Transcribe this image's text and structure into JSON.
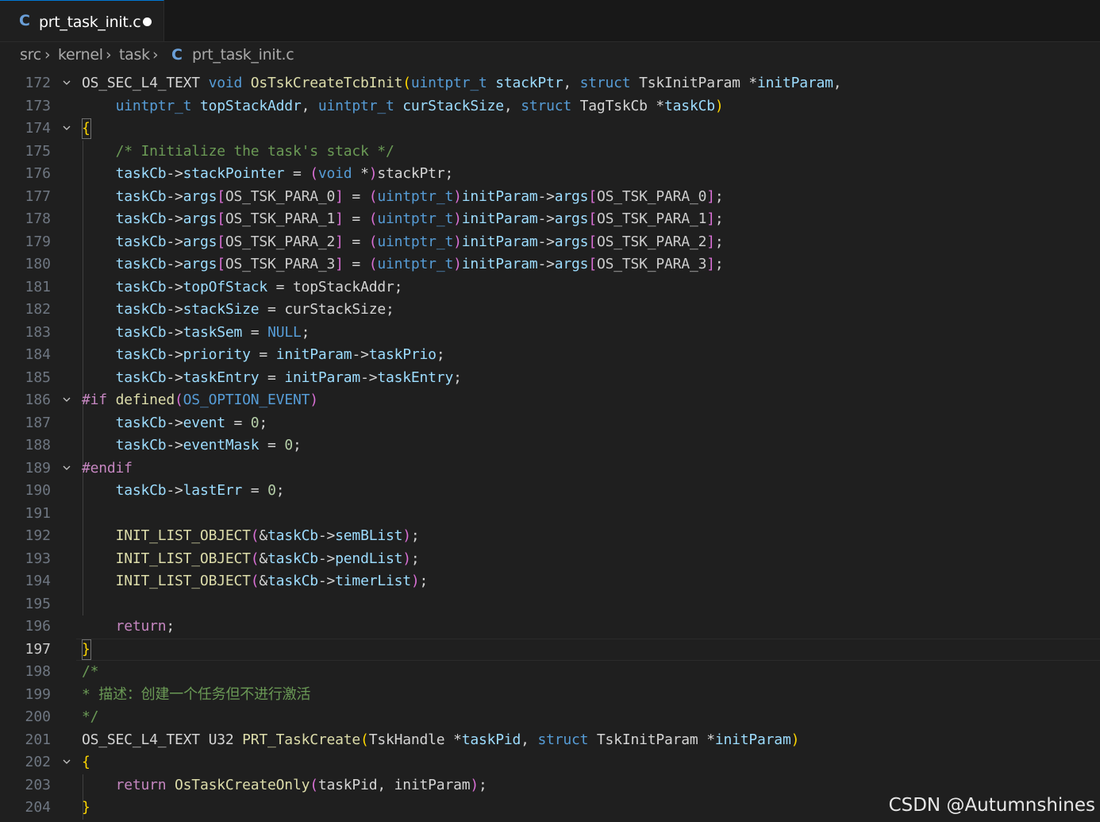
{
  "tab": {
    "icon": "c-language-icon",
    "icon_text": "C",
    "label": "prt_task_init.c",
    "dirty": true
  },
  "breadcrumb": {
    "items": [
      "src",
      "kernel",
      "task"
    ],
    "file_icon_text": "C",
    "file": "prt_task_init.c"
  },
  "active_line": 197,
  "lines": [
    {
      "n": "172",
      "fold": true,
      "t": [
        [
          "OS_SEC_L4_TEXT ",
          "plain"
        ],
        [
          "void ",
          "kw"
        ],
        [
          "OsTskCreateTcbInit",
          "fn"
        ],
        [
          "(",
          "p1"
        ],
        [
          "uintptr_t ",
          "kw"
        ],
        [
          "stackPtr",
          "var"
        ],
        [
          ", ",
          "plain"
        ],
        [
          "struct ",
          "kw"
        ],
        [
          "TskInitParam ",
          "plain"
        ],
        [
          "*",
          "plain"
        ],
        [
          "initParam",
          "var"
        ],
        [
          ",",
          "plain"
        ]
      ]
    },
    {
      "n": "173",
      "fold": false,
      "t": [
        [
          "    ",
          "plain"
        ],
        [
          "uintptr_t ",
          "kw"
        ],
        [
          "topStackAddr",
          "var"
        ],
        [
          ", ",
          "plain"
        ],
        [
          "uintptr_t ",
          "kw"
        ],
        [
          "curStackSize",
          "var"
        ],
        [
          ", ",
          "plain"
        ],
        [
          "struct ",
          "kw"
        ],
        [
          "TagTskCb ",
          "plain"
        ],
        [
          "*",
          "plain"
        ],
        [
          "taskCb",
          "var"
        ],
        [
          ")",
          "p1"
        ]
      ]
    },
    {
      "n": "174",
      "fold": true,
      "t": [
        [
          "{",
          "p1"
        ]
      ]
    },
    {
      "n": "175",
      "fold": false,
      "t": [
        [
          "    ",
          "plain"
        ],
        [
          "/* Initialize the task's stack */",
          "cm"
        ]
      ]
    },
    {
      "n": "176",
      "fold": false,
      "t": [
        [
          "    ",
          "plain"
        ],
        [
          "taskCb",
          "var"
        ],
        [
          "->",
          "plain"
        ],
        [
          "stackPointer",
          "var"
        ],
        [
          " = ",
          "plain"
        ],
        [
          "(",
          "p2"
        ],
        [
          "void ",
          "kw"
        ],
        [
          "*",
          "plain"
        ],
        [
          ")",
          "p2"
        ],
        [
          "stackPtr",
          "plain"
        ],
        [
          ";",
          "plain"
        ]
      ]
    },
    {
      "n": "177",
      "fold": false,
      "t": [
        [
          "    ",
          "plain"
        ],
        [
          "taskCb",
          "var"
        ],
        [
          "->",
          "plain"
        ],
        [
          "args",
          "var"
        ],
        [
          "[",
          "p2"
        ],
        [
          "OS_TSK_PARA_0",
          "mac"
        ],
        [
          "]",
          "p2"
        ],
        [
          " = ",
          "plain"
        ],
        [
          "(",
          "p2"
        ],
        [
          "uintptr_t",
          "kw"
        ],
        [
          ")",
          "p2"
        ],
        [
          "initParam",
          "var"
        ],
        [
          "->",
          "plain"
        ],
        [
          "args",
          "var"
        ],
        [
          "[",
          "p2"
        ],
        [
          "OS_TSK_PARA_0",
          "mac"
        ],
        [
          "]",
          "p2"
        ],
        [
          ";",
          "plain"
        ]
      ]
    },
    {
      "n": "178",
      "fold": false,
      "t": [
        [
          "    ",
          "plain"
        ],
        [
          "taskCb",
          "var"
        ],
        [
          "->",
          "plain"
        ],
        [
          "args",
          "var"
        ],
        [
          "[",
          "p2"
        ],
        [
          "OS_TSK_PARA_1",
          "mac"
        ],
        [
          "]",
          "p2"
        ],
        [
          " = ",
          "plain"
        ],
        [
          "(",
          "p2"
        ],
        [
          "uintptr_t",
          "kw"
        ],
        [
          ")",
          "p2"
        ],
        [
          "initParam",
          "var"
        ],
        [
          "->",
          "plain"
        ],
        [
          "args",
          "var"
        ],
        [
          "[",
          "p2"
        ],
        [
          "OS_TSK_PARA_1",
          "mac"
        ],
        [
          "]",
          "p2"
        ],
        [
          ";",
          "plain"
        ]
      ]
    },
    {
      "n": "179",
      "fold": false,
      "t": [
        [
          "    ",
          "plain"
        ],
        [
          "taskCb",
          "var"
        ],
        [
          "->",
          "plain"
        ],
        [
          "args",
          "var"
        ],
        [
          "[",
          "p2"
        ],
        [
          "OS_TSK_PARA_2",
          "mac"
        ],
        [
          "]",
          "p2"
        ],
        [
          " = ",
          "plain"
        ],
        [
          "(",
          "p2"
        ],
        [
          "uintptr_t",
          "kw"
        ],
        [
          ")",
          "p2"
        ],
        [
          "initParam",
          "var"
        ],
        [
          "->",
          "plain"
        ],
        [
          "args",
          "var"
        ],
        [
          "[",
          "p2"
        ],
        [
          "OS_TSK_PARA_2",
          "mac"
        ],
        [
          "]",
          "p2"
        ],
        [
          ";",
          "plain"
        ]
      ]
    },
    {
      "n": "180",
      "fold": false,
      "t": [
        [
          "    ",
          "plain"
        ],
        [
          "taskCb",
          "var"
        ],
        [
          "->",
          "plain"
        ],
        [
          "args",
          "var"
        ],
        [
          "[",
          "p2"
        ],
        [
          "OS_TSK_PARA_3",
          "mac"
        ],
        [
          "]",
          "p2"
        ],
        [
          " = ",
          "plain"
        ],
        [
          "(",
          "p2"
        ],
        [
          "uintptr_t",
          "kw"
        ],
        [
          ")",
          "p2"
        ],
        [
          "initParam",
          "var"
        ],
        [
          "->",
          "plain"
        ],
        [
          "args",
          "var"
        ],
        [
          "[",
          "p2"
        ],
        [
          "OS_TSK_PARA_3",
          "mac"
        ],
        [
          "]",
          "p2"
        ],
        [
          ";",
          "plain"
        ]
      ]
    },
    {
      "n": "181",
      "fold": false,
      "t": [
        [
          "    ",
          "plain"
        ],
        [
          "taskCb",
          "var"
        ],
        [
          "->",
          "plain"
        ],
        [
          "topOfStack",
          "var"
        ],
        [
          " = ",
          "plain"
        ],
        [
          "topStackAddr",
          "plain"
        ],
        [
          ";",
          "plain"
        ]
      ]
    },
    {
      "n": "182",
      "fold": false,
      "t": [
        [
          "    ",
          "plain"
        ],
        [
          "taskCb",
          "var"
        ],
        [
          "->",
          "plain"
        ],
        [
          "stackSize",
          "var"
        ],
        [
          " = ",
          "plain"
        ],
        [
          "curStackSize",
          "plain"
        ],
        [
          ";",
          "plain"
        ]
      ]
    },
    {
      "n": "183",
      "fold": false,
      "t": [
        [
          "    ",
          "plain"
        ],
        [
          "taskCb",
          "var"
        ],
        [
          "->",
          "plain"
        ],
        [
          "taskSem",
          "var"
        ],
        [
          " = ",
          "plain"
        ],
        [
          "NULL",
          "kw"
        ],
        [
          ";",
          "plain"
        ]
      ]
    },
    {
      "n": "184",
      "fold": false,
      "t": [
        [
          "    ",
          "plain"
        ],
        [
          "taskCb",
          "var"
        ],
        [
          "->",
          "plain"
        ],
        [
          "priority",
          "var"
        ],
        [
          " = ",
          "plain"
        ],
        [
          "initParam",
          "var"
        ],
        [
          "->",
          "plain"
        ],
        [
          "taskPrio",
          "var"
        ],
        [
          ";",
          "plain"
        ]
      ]
    },
    {
      "n": "185",
      "fold": false,
      "t": [
        [
          "    ",
          "plain"
        ],
        [
          "taskCb",
          "var"
        ],
        [
          "->",
          "plain"
        ],
        [
          "taskEntry",
          "var"
        ],
        [
          " = ",
          "plain"
        ],
        [
          "initParam",
          "var"
        ],
        [
          "->",
          "plain"
        ],
        [
          "taskEntry",
          "var"
        ],
        [
          ";",
          "plain"
        ]
      ]
    },
    {
      "n": "186",
      "fold": true,
      "t": [
        [
          "#if ",
          "ctrl"
        ],
        [
          "defined",
          "fn"
        ],
        [
          "(",
          "p2"
        ],
        [
          "OS_OPTION_EVENT",
          "kw"
        ],
        [
          ")",
          "p2"
        ]
      ]
    },
    {
      "n": "187",
      "fold": false,
      "t": [
        [
          "    ",
          "plain"
        ],
        [
          "taskCb",
          "var"
        ],
        [
          "->",
          "plain"
        ],
        [
          "event",
          "var"
        ],
        [
          " = ",
          "plain"
        ],
        [
          "0",
          "num"
        ],
        [
          ";",
          "plain"
        ]
      ]
    },
    {
      "n": "188",
      "fold": false,
      "t": [
        [
          "    ",
          "plain"
        ],
        [
          "taskCb",
          "var"
        ],
        [
          "->",
          "plain"
        ],
        [
          "eventMask",
          "var"
        ],
        [
          " = ",
          "plain"
        ],
        [
          "0",
          "num"
        ],
        [
          ";",
          "plain"
        ]
      ]
    },
    {
      "n": "189",
      "fold": true,
      "t": [
        [
          "#endif",
          "ctrl"
        ]
      ]
    },
    {
      "n": "190",
      "fold": false,
      "t": [
        [
          "    ",
          "plain"
        ],
        [
          "taskCb",
          "var"
        ],
        [
          "->",
          "plain"
        ],
        [
          "lastErr",
          "var"
        ],
        [
          " = ",
          "plain"
        ],
        [
          "0",
          "num"
        ],
        [
          ";",
          "plain"
        ]
      ]
    },
    {
      "n": "191",
      "fold": false,
      "t": []
    },
    {
      "n": "192",
      "fold": false,
      "t": [
        [
          "    ",
          "plain"
        ],
        [
          "INIT_LIST_OBJECT",
          "fn"
        ],
        [
          "(",
          "p2"
        ],
        [
          "&",
          "plain"
        ],
        [
          "taskCb",
          "var"
        ],
        [
          "->",
          "plain"
        ],
        [
          "semBList",
          "var"
        ],
        [
          ")",
          "p2"
        ],
        [
          ";",
          "plain"
        ]
      ]
    },
    {
      "n": "193",
      "fold": false,
      "t": [
        [
          "    ",
          "plain"
        ],
        [
          "INIT_LIST_OBJECT",
          "fn"
        ],
        [
          "(",
          "p2"
        ],
        [
          "&",
          "plain"
        ],
        [
          "taskCb",
          "var"
        ],
        [
          "->",
          "plain"
        ],
        [
          "pendList",
          "var"
        ],
        [
          ")",
          "p2"
        ],
        [
          ";",
          "plain"
        ]
      ]
    },
    {
      "n": "194",
      "fold": false,
      "t": [
        [
          "    ",
          "plain"
        ],
        [
          "INIT_LIST_OBJECT",
          "fn"
        ],
        [
          "(",
          "p2"
        ],
        [
          "&",
          "plain"
        ],
        [
          "taskCb",
          "var"
        ],
        [
          "->",
          "plain"
        ],
        [
          "timerList",
          "var"
        ],
        [
          ")",
          "p2"
        ],
        [
          ";",
          "plain"
        ]
      ]
    },
    {
      "n": "195",
      "fold": false,
      "t": []
    },
    {
      "n": "196",
      "fold": false,
      "t": [
        [
          "    ",
          "plain"
        ],
        [
          "return",
          "ctrl"
        ],
        [
          ";",
          "plain"
        ]
      ]
    },
    {
      "n": "197",
      "fold": false,
      "t": [
        [
          "}",
          "p1"
        ]
      ]
    },
    {
      "n": "198",
      "fold": false,
      "t": [
        [
          "/*",
          "cm"
        ]
      ]
    },
    {
      "n": "199",
      "fold": false,
      "t": [
        [
          "* 描述：创建一个任务但不进行激活",
          "cm"
        ]
      ]
    },
    {
      "n": "200",
      "fold": false,
      "t": [
        [
          "*/",
          "cm"
        ]
      ]
    },
    {
      "n": "201",
      "fold": false,
      "t": [
        [
          "OS_SEC_L4_TEXT ",
          "plain"
        ],
        [
          "U32 ",
          "plain"
        ],
        [
          "PRT_TaskCreate",
          "fn"
        ],
        [
          "(",
          "p1"
        ],
        [
          "TskHandle ",
          "plain"
        ],
        [
          "*",
          "plain"
        ],
        [
          "taskPid",
          "var"
        ],
        [
          ", ",
          "plain"
        ],
        [
          "struct ",
          "kw"
        ],
        [
          "TskInitParam ",
          "plain"
        ],
        [
          "*",
          "plain"
        ],
        [
          "initParam",
          "var"
        ],
        [
          ")",
          "p1"
        ]
      ]
    },
    {
      "n": "202",
      "fold": true,
      "t": [
        [
          "{",
          "p1"
        ]
      ]
    },
    {
      "n": "203",
      "fold": false,
      "t": [
        [
          "    ",
          "plain"
        ],
        [
          "return ",
          "ctrl"
        ],
        [
          "OsTaskCreateOnly",
          "fn"
        ],
        [
          "(",
          "p2"
        ],
        [
          "taskPid",
          "plain"
        ],
        [
          ", ",
          "plain"
        ],
        [
          "initParam",
          "plain"
        ],
        [
          ")",
          "p2"
        ],
        [
          ";",
          "plain"
        ]
      ]
    },
    {
      "n": "204",
      "fold": false,
      "t": [
        [
          "}",
          "p1"
        ]
      ]
    }
  ],
  "watermark": "CSDN @Autumnshines"
}
